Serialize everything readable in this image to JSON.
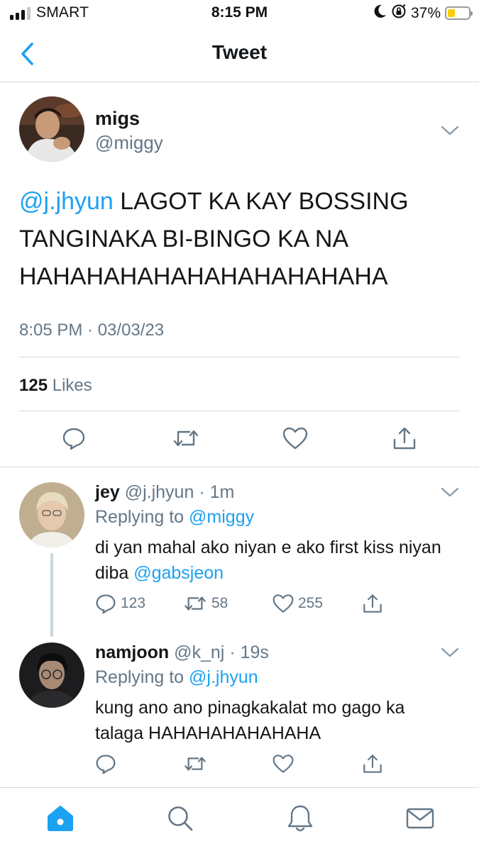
{
  "status_bar": {
    "carrier": "SMART",
    "time": "8:15 PM",
    "battery_percent": "37%",
    "battery_level": 0.37,
    "icons": [
      "signal-icon",
      "moon-icon",
      "orientation-lock-icon",
      "battery-icon"
    ]
  },
  "nav": {
    "title": "Tweet",
    "back_icon": "chevron-left-icon",
    "accent_color": "#1da1f2"
  },
  "main_tweet": {
    "name": "migs",
    "handle": "@miggy",
    "mention": "@j.jhyun",
    "text": " LAGOT KA KAY BOSSING TANGINAKA BI-BINGO KA NA HAHAHAHAHAHAHAHAHAHAHA",
    "timestamp": "8:05 PM · 03/03/23",
    "likes_count": "125",
    "likes_label": "Likes",
    "actions": [
      "reply-icon",
      "retweet-icon",
      "like-icon",
      "share-icon"
    ]
  },
  "replies": [
    {
      "name": "jey",
      "handle": "@j.jhyun",
      "time": "1m",
      "replying_prefix": "Replying to",
      "replying_to": "@miggy",
      "text": "di yan mahal ako niyan e ako first kiss niyan diba ",
      "text_mention": "@gabsjeon",
      "reply_count": "123",
      "retweet_count": "58",
      "like_count": "255"
    },
    {
      "name": "namjoon",
      "handle": "@k_nj",
      "time": "19s",
      "replying_prefix": "Replying to",
      "replying_to": "@j.jhyun",
      "text": "kung ano ano pinagkakalat mo gago ka talaga HAHAHAHAHAHAHA",
      "text_mention": "",
      "reply_count": "",
      "retweet_count": "",
      "like_count": ""
    }
  ],
  "tab_bar": {
    "tabs": [
      "home-icon",
      "search-icon",
      "notifications-icon",
      "messages-icon"
    ],
    "active": "home-icon"
  }
}
